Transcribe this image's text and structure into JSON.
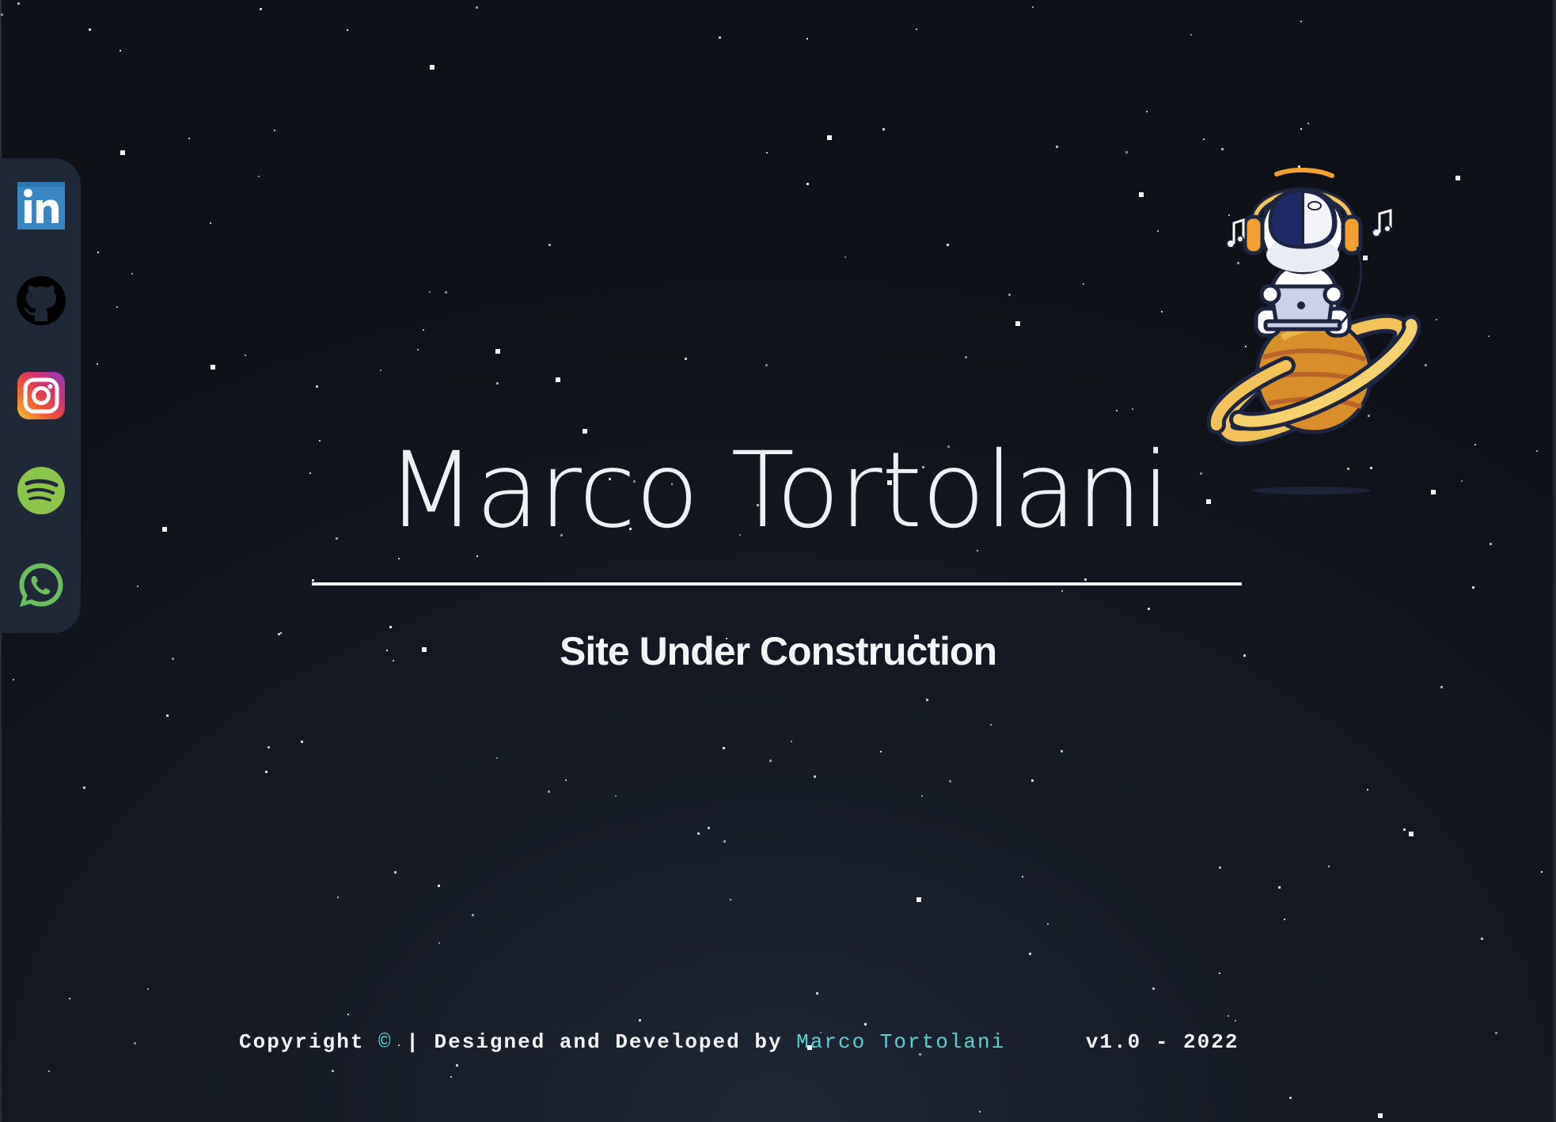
{
  "site": {
    "title": "Marco Tortolani",
    "subtitle": "Site Under Construction"
  },
  "social": [
    {
      "name": "LinkedIn",
      "icon": "linkedin-icon",
      "color": "#2f7ab6"
    },
    {
      "name": "GitHub",
      "icon": "github-icon",
      "color": "#000000"
    },
    {
      "name": "Instagram",
      "icon": "instagram-icon",
      "color": "#d6316e"
    },
    {
      "name": "Spotify",
      "icon": "spotify-icon",
      "color": "#8bc54a"
    },
    {
      "name": "WhatsApp",
      "icon": "whatsapp-icon",
      "color": "#6abf5c"
    }
  ],
  "footer": {
    "copyright_label": "Copyright",
    "copyright_symbol": "©",
    "separator": "|",
    "designed_label": "Designed and Developed by",
    "author_link": "Marco Tortolani",
    "version": "v1.0 - 2022"
  },
  "colors": {
    "accent": "#5ad1d3",
    "background": "#141922",
    "sidebar": "#1f2837",
    "text": "#eef1f4"
  }
}
